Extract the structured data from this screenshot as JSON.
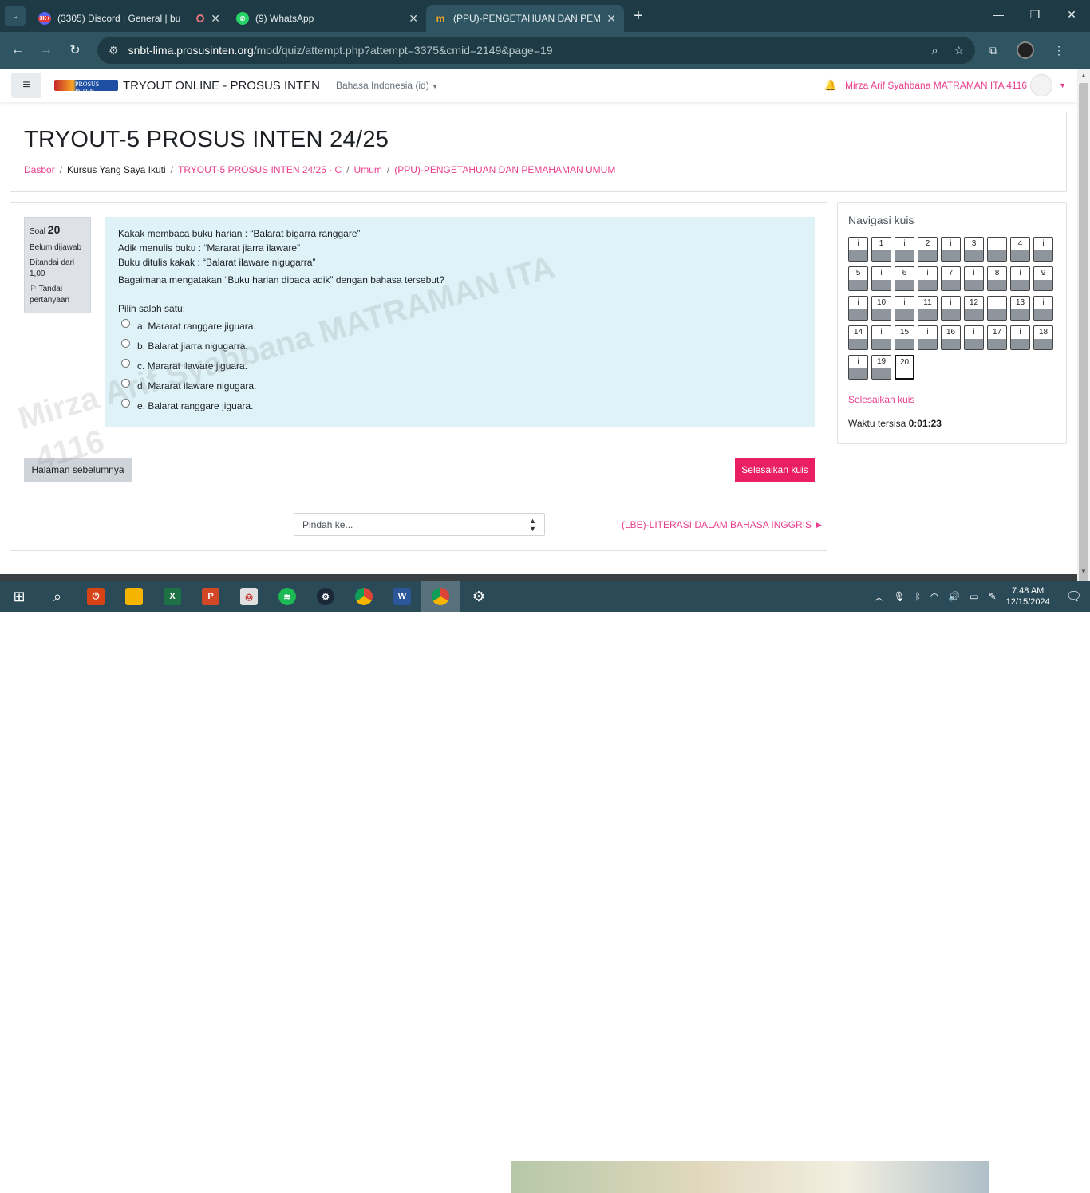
{
  "browser": {
    "tabs": [
      {
        "title": "(3305) Discord | General | bu",
        "badge": "3K+",
        "active": false,
        "recording": true
      },
      {
        "title": "(9) WhatsApp",
        "active": false
      },
      {
        "title": "(PPU)-PENGETAHUAN DAN PEM",
        "active": true
      }
    ],
    "url": {
      "host": "snbt-lima.prosusinten.org",
      "path": "/mod/quiz/attempt.php?attempt=3375&cmid=2149&page=19"
    }
  },
  "site": {
    "logo_text": "PROSUS INTEN",
    "name": "TRYOUT ONLINE - PROSUS INTEN",
    "language": "Bahasa Indonesia (id)",
    "user_name": "Mirza Arif Syahbana MATRAMAN ITA 4116"
  },
  "header": {
    "title": "TRYOUT-5 PROSUS INTEN 24/25",
    "breadcrumb": [
      {
        "label": "Dasbor",
        "link": true
      },
      {
        "label": "Kursus Yang Saya Ikuti",
        "link": false
      },
      {
        "label": "TRYOUT-5 PROSUS INTEN 24/25 - C",
        "link": true
      },
      {
        "label": "Umum",
        "link": true
      },
      {
        "label": "(PPU)-PENGETAHUAN DAN PEMAHAMAN UMUM",
        "link": true
      }
    ]
  },
  "question": {
    "label": "Soal",
    "number": "20",
    "state": "Belum dijawab",
    "mark": "Ditandai dari 1,00",
    "flag": "Tandai pertanyaan",
    "lines": [
      "Kakak membaca buku harian : “Balarat bigarra ranggare”",
      "Adik menulis buku : “Mararat jiarra ilaware”",
      "Buku ditulis kakak : “Balarat ilaware nigugarra”"
    ],
    "prompt": "Bagaimana mengatakan “Buku harian dibaca adik” dengan bahasa tersebut?",
    "choose": "Pilih salah satu:",
    "options": [
      "a. Mararat ranggare jiguara.",
      "b. Balarat jiarra nigugarra.",
      "c. Mararat ilaware jiguara.",
      "d. Mararat ilaware nigugara.",
      "e. Balarat ranggare jiguara."
    ]
  },
  "actions": {
    "prev": "Halaman sebelumnya",
    "finish": "Selesaikan kuis",
    "jump_placeholder": "Pindah ke...",
    "next_link": "(LBE)-LITERASI DALAM BAHASA INGGRIS ►"
  },
  "nav": {
    "title": "Navigasi kuis",
    "cells": [
      "i",
      "1",
      "i",
      "2",
      "i",
      "3",
      "i",
      "4",
      "i",
      "5",
      "i",
      "6",
      "i",
      "7",
      "i",
      "8",
      "i",
      "9",
      "i",
      "10",
      "i",
      "11",
      "i",
      "12",
      "i",
      "13",
      "i",
      "14",
      "i",
      "15",
      "i",
      "16",
      "i",
      "17",
      "i",
      "18",
      "i",
      "19",
      "20"
    ],
    "current": "20",
    "finish": "Selesaikan kuis",
    "time_label": "Waktu tersisa",
    "time_value": "0:01:23"
  },
  "watermark": [
    "Mirza Arif Syahbana MATRAMAN ITA",
    "4116"
  ],
  "taskbar": {
    "time": "7:48 AM",
    "date": "12/15/2024"
  },
  "colors": {
    "accent": "#e83e8c",
    "finish_button": "#e91e63",
    "question_bg": "#def2f8"
  }
}
